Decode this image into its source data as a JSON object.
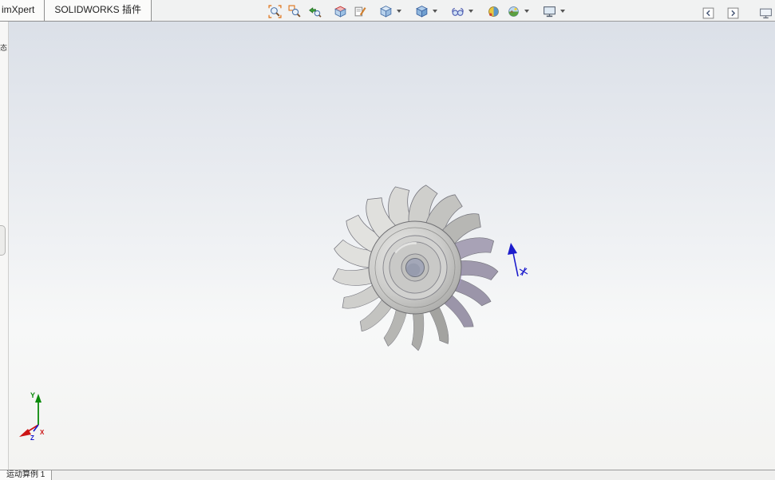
{
  "command_tabs": {
    "items": [
      {
        "label": "imXpert"
      },
      {
        "label": "SOLIDWORKS 插件"
      }
    ]
  },
  "headsup_toolbar": {
    "icons": [
      "zoom-to-fit",
      "zoom-to-area",
      "previous-view",
      "section-view",
      "annotation-views",
      "view-orientation",
      "display-style",
      "hide-show-items",
      "edit-appearance",
      "apply-scene",
      "view-settings"
    ]
  },
  "window_controls": {
    "icons": [
      "collapse-pane-left",
      "collapse-pane-right",
      "fullscreen"
    ]
  },
  "left_panel": {
    "vertical_label": "态",
    "icons": [
      "tree-item",
      "tree-item",
      "tree-item"
    ]
  },
  "viewport": {
    "model": "turbine-wheel",
    "triad": {
      "x_label": "X",
      "y_label": "Y",
      "z_label": "Z"
    },
    "colors": {
      "triad_x": "#cc1515",
      "triad_y": "#0a8a0a",
      "triad_z": "#1515cc",
      "annotation_arrow": "#1c1ccc",
      "background_top": "#dbe0e8",
      "background_bottom": "#f3f3f1"
    }
  },
  "status_bar": {
    "motion_study_tab": "运动算例 1"
  }
}
